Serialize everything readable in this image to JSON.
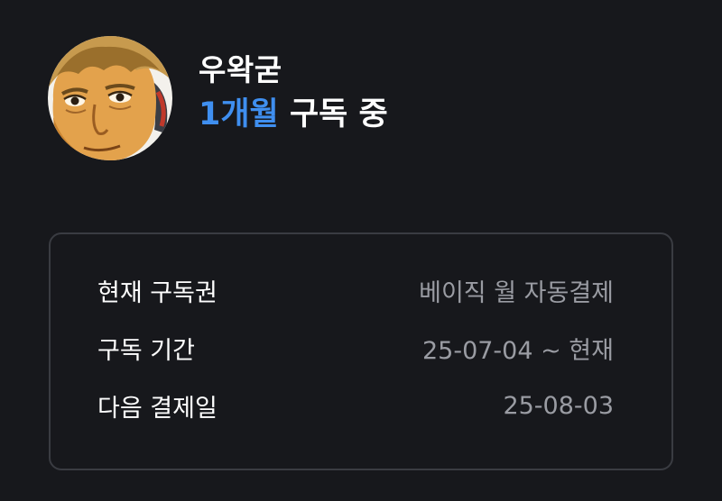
{
  "profile": {
    "avatar_icon": "cartoon-face-avatar",
    "username": "우왁굳",
    "subscription": {
      "highlight": "1개월",
      "suffix": " 구독 중",
      "highlight_color": "#3f8ff0"
    }
  },
  "details": {
    "rows": [
      {
        "label": "현재 구독권",
        "value": "베이직 월 자동결제"
      },
      {
        "label": "구독 기간",
        "value": "25-07-04 ~ 현재"
      },
      {
        "label": "다음 결제일",
        "value": "25-08-03"
      }
    ]
  }
}
